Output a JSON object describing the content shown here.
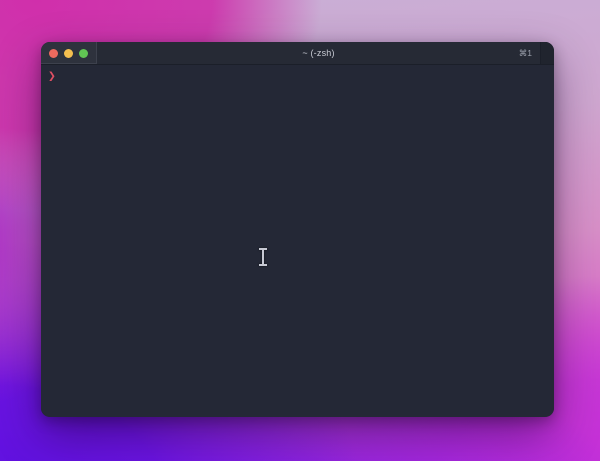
{
  "window": {
    "app": "iTerm2 terminal window",
    "tab": {
      "title": "~ (-zsh)",
      "shortcut": "⌘1"
    },
    "traffic_lights": {
      "close": "close",
      "minimize": "minimize",
      "zoom": "zoom"
    }
  },
  "terminal": {
    "prompt_symbol": "❯"
  },
  "cursor": {
    "type": "i-beam"
  },
  "colors": {
    "terminal_bg": "#242836",
    "tab_bg": "#262a35",
    "controls_bg": "#2e323d",
    "title_color": "#c9ccd5",
    "shortcut_color": "#9ba0ac",
    "prompt_color": "#df4f63",
    "light_red": "#ed6a5e",
    "light_yellow": "#f4bf4f",
    "light_green": "#61c554",
    "cursor_color": "#c7c9d3"
  }
}
